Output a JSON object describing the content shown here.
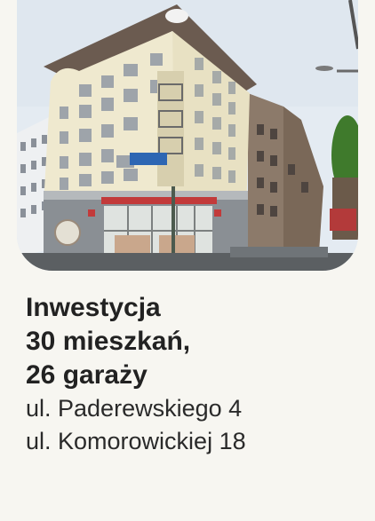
{
  "title_lines": [
    "Inwestycja",
    "30 mieszkań,",
    "26 garaży"
  ],
  "address_lines": [
    "ul. Paderewskiego 4",
    "ul. Komorowickiej 18"
  ],
  "colors": {
    "background": "#f7f6f1",
    "text": "#222222",
    "facade": "#efe9cf",
    "roof": "#6b5b50"
  }
}
